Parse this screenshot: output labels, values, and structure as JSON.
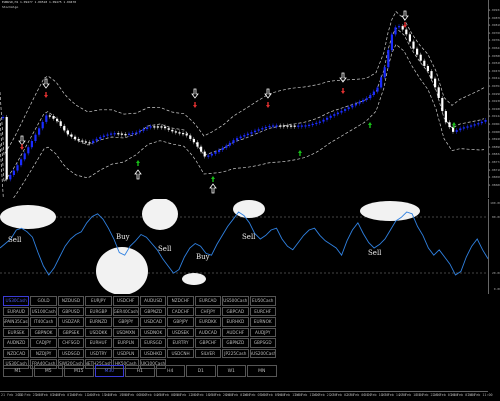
{
  "header": {
    "ohlc": "EURUSD,H1 1.09477 1.09518 1.09475 1.09478",
    "indicator": "StochAlgo"
  },
  "price_axis": [
    "1.09934",
    "1.09876",
    "1.09818",
    "1.09760",
    "1.09702",
    "1.09644",
    "1.09586",
    "1.09528",
    "1.09470",
    "1.09412",
    "1.09354",
    "1.09296",
    "1.09238",
    "1.09180",
    "1.09122",
    "1.09064",
    "1.09006",
    "1.08948",
    "1.08890",
    "1.08832",
    "1.08774",
    "1.08716",
    "1.08658",
    "1.08600"
  ],
  "osc_axis": [
    "100.00",
    "80.00",
    "20.00",
    "0.00"
  ],
  "osc_labels": [
    "Sell",
    "Buy",
    "Sell",
    "Buy",
    "Sell",
    "Sell"
  ],
  "symbols": [
    "US30Cash",
    "GOLD",
    "NZDUSD",
    "EURJPY",
    "USDCHF",
    "AUDUSD",
    "NZDCHF",
    "EURCAD",
    "US500Cash",
    "EU50Cash",
    "EURAUD",
    "US100Cash",
    "GBPUSD",
    "EURGBP",
    "GER40Cash",
    "GBPNZD",
    "CADCHF",
    "CHFJPY",
    "GBPCAD",
    "EURCHF",
    "SPAIN35Cash",
    "IT40Cash",
    "USDZAR",
    "EURNZD",
    "GBPJPY",
    "USDCAD",
    "GBPJPY",
    "EURDKK",
    "EURHKD",
    "EURNOK",
    "EURSEK",
    "GBPNOK",
    "GBPSEK",
    "USDDKK",
    "USDMXN",
    "USDNOK",
    "USDSEK",
    "AUDCAD",
    "AUDCHF",
    "AUDJPY",
    "AUDNZD",
    "CADJPY",
    "CHFSGD",
    "EURHUF",
    "EURPLN",
    "EURSGD",
    "EURTRY",
    "GBPCHF",
    "GBPNZD",
    "GBPSGD",
    "NZDCAD",
    "NZDJPY",
    "USDSGD",
    "USDTRY",
    "USDPLN",
    "USDHKD",
    "USDCNH",
    "SILVER",
    "JP225Cash",
    "AUS200Cash",
    "US30Cash",
    "FRA40Cash",
    "SWI20Cash",
    "NETH25Cash",
    "HK50Cash",
    "UK100Cash"
  ],
  "timeframes": [
    "M1",
    "M5",
    "M15",
    "M30",
    "H1",
    "H4",
    "D1",
    "W1",
    "MN"
  ],
  "time_axis": [
    "21 Feb 2020",
    "21 Feb 23:00",
    "24 Feb 03:00",
    "24 Feb 07:00",
    "24 Feb 11:00",
    "24 Feb 15:00",
    "24 Feb 19:00",
    "25 Feb 00:00",
    "25 Feb 04:00",
    "25 Feb 08:00",
    "25 Feb 12:00",
    "25 Feb 16:00",
    "25 Feb 20:00",
    "26 Feb 01:00",
    "26 Feb 05:00",
    "26 Feb 09:00",
    "26 Feb 13:00",
    "26 Feb 17:00",
    "26 Feb 21:00",
    "27 Feb 02:00",
    "27 Feb 06:00",
    "27 Feb 10:00",
    "27 Feb 14:00",
    "27 Feb 18:00",
    "27 Feb 22:00",
    "28 Feb 03:00",
    "28 Feb 07:00",
    "28 Feb 11:00"
  ],
  "colors": {
    "bull": "#1a2cff",
    "bear": "#ffffff",
    "band": "#cfcfcf",
    "osc": "#2f80e0",
    "buy_arrow": "#18c018",
    "sell_arrow": "#e03030",
    "active": "#4a5ae8"
  }
}
